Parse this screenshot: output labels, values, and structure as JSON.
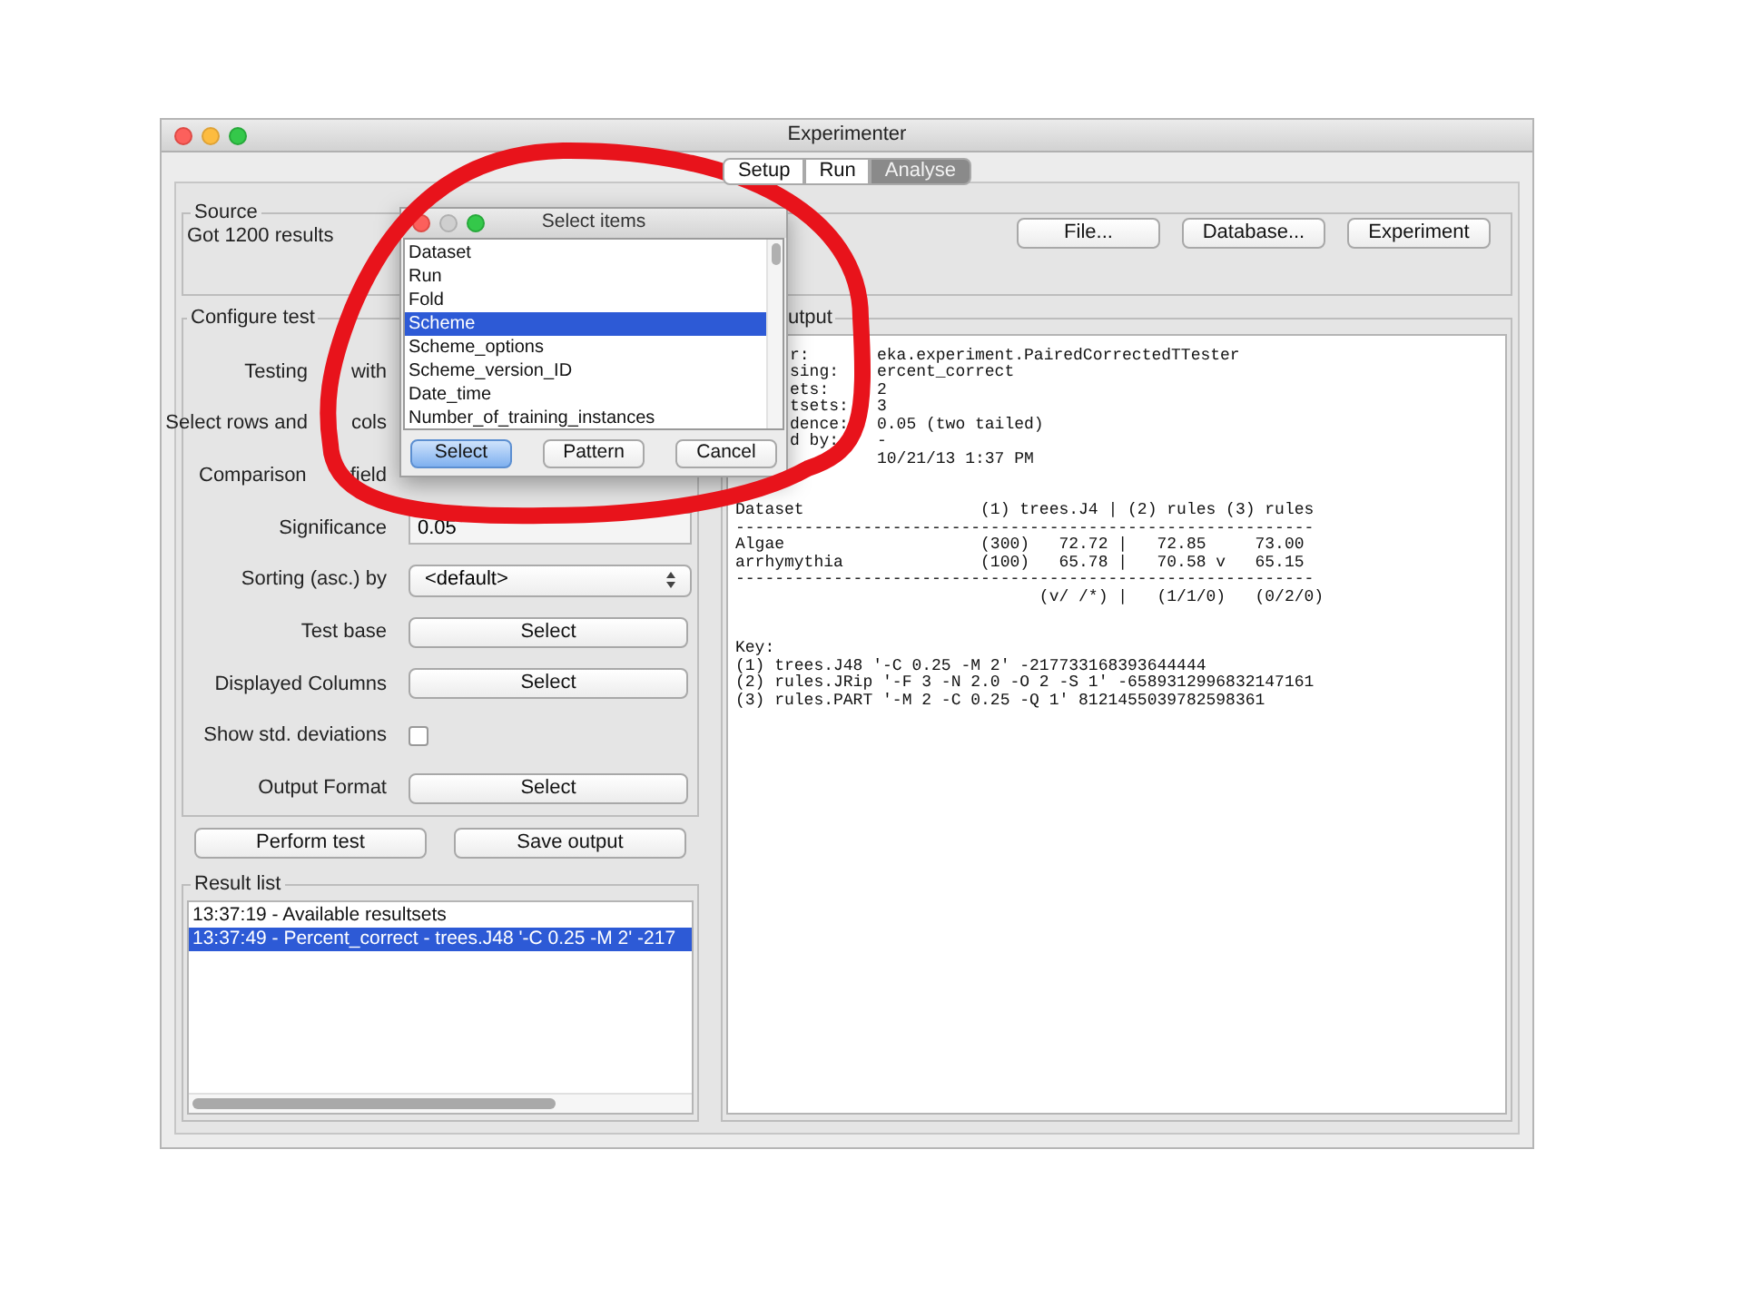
{
  "window": {
    "title": "Experimenter"
  },
  "tabs": [
    {
      "label": "Setup",
      "selected": false
    },
    {
      "label": "Run",
      "selected": false
    },
    {
      "label": "Analyse",
      "selected": true
    }
  ],
  "source": {
    "legend": "Source",
    "status": "Got 1200 results",
    "buttons": [
      "File...",
      "Database...",
      "Experiment"
    ]
  },
  "configure": {
    "legend": "Configure test",
    "rows": [
      {
        "kind": "covered",
        "label_parts": [
          "Testing",
          "with"
        ]
      },
      {
        "kind": "covered",
        "label_parts": [
          "Select rows and",
          "cols"
        ]
      },
      {
        "kind": "covered",
        "label_parts": [
          "Comparison",
          "field"
        ]
      },
      {
        "kind": "field",
        "label": "Significance",
        "value": "0.05"
      },
      {
        "kind": "dropdown",
        "label": "Sorting (asc.) by",
        "value": "<default>"
      },
      {
        "kind": "button",
        "label": "Test base",
        "button": "Select"
      },
      {
        "kind": "button",
        "label": "Displayed Columns",
        "button": "Select"
      },
      {
        "kind": "checkbox",
        "label": "Show std. deviations",
        "checked": false
      },
      {
        "kind": "button",
        "label": "Output Format",
        "button": "Select"
      }
    ]
  },
  "actions": [
    "Perform test",
    "Save output"
  ],
  "result_list": {
    "legend": "Result list",
    "items": [
      {
        "text": "13:37:19 - Available resultsets",
        "selected": false
      },
      {
        "text": "13:37:49 - Percent_correct - trees.J48 '-C 0.25 -M 2' -217",
        "selected": true
      }
    ]
  },
  "output": {
    "legend": "utput",
    "header": [
      {
        "key": "r:",
        "value": "eka.experiment.PairedCorrectedTTester"
      },
      {
        "key": "sing:",
        "value": "ercent_correct"
      },
      {
        "key": "ets:",
        "value": "2"
      },
      {
        "key": "tsets:",
        "value": "3"
      },
      {
        "key": "dence:",
        "value": "0.05 (two tailed)"
      },
      {
        "key": "d by:",
        "value": "-"
      },
      {
        "value": "10/21/13 1:37 PM"
      }
    ],
    "table": [
      "Dataset                  (1) trees.J4 | (2) rules (3) rules",
      "-----------------------------------------------------------",
      "Algae                    (300)   72.72 |   72.85     73.00",
      "arrhymythia              (100)   65.78 |   70.58 v   65.15",
      "-----------------------------------------------------------",
      "                               (v/ /*) |   (1/1/0)   (0/2/0)"
    ],
    "key_title": "Key:",
    "key_lines": [
      "(1) trees.J48 '-C 0.25 -M 2' -217733168393644444",
      "(2) rules.JRip '-F 3 -N 2.0 -O 2 -S 1' -6589312996832147161",
      "(3) rules.PART '-M 2 -C 0.25 -Q 1' 8121455039782598361"
    ]
  },
  "dialog": {
    "title": "Select items",
    "items": [
      {
        "text": "Dataset",
        "selected": false
      },
      {
        "text": "Run",
        "selected": false
      },
      {
        "text": "Fold",
        "selected": false
      },
      {
        "text": "Scheme",
        "selected": true
      },
      {
        "text": "Scheme_options",
        "selected": false
      },
      {
        "text": "Scheme_version_ID",
        "selected": false
      },
      {
        "text": "Date_time",
        "selected": false
      },
      {
        "text": "Number_of_training_instances",
        "selected": false
      }
    ],
    "buttons": [
      {
        "label": "Select",
        "default": true
      },
      {
        "label": "Pattern",
        "default": false
      },
      {
        "label": "Cancel",
        "default": false
      }
    ]
  }
}
